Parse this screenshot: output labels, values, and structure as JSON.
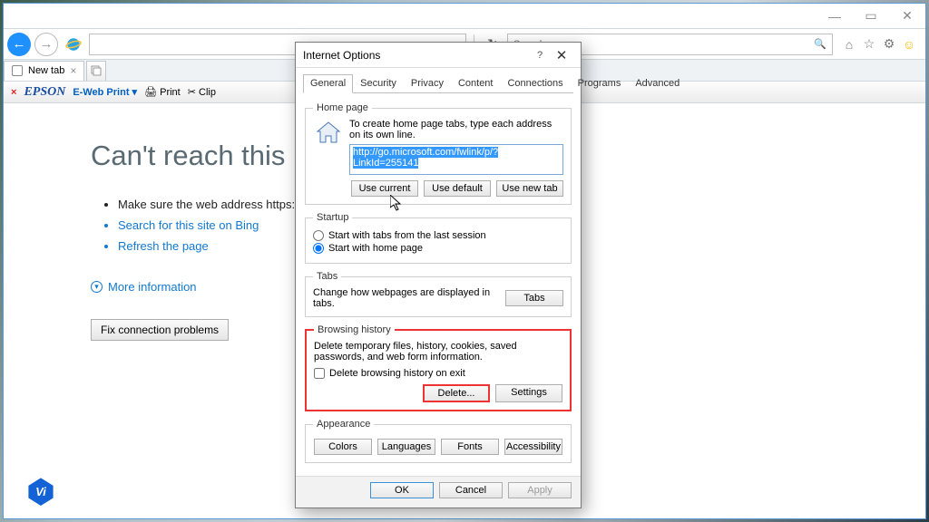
{
  "window": {
    "controls": {
      "min": "—",
      "max": "▭",
      "close": "✕"
    }
  },
  "navbar": {
    "search_placeholder": "Search...",
    "icons": {
      "home": "⌂",
      "star": "☆",
      "gear": "⚙",
      "smile": "☺"
    }
  },
  "tabstrip": {
    "tab_label": "New tab"
  },
  "toolbar": {
    "epson": "EPSON",
    "eweb": "E-Web Print",
    "dropdown": "▾",
    "print": "Print",
    "clip": "Clip"
  },
  "errorpage": {
    "title": "Can't reach this pa",
    "bullet1": "Make sure the web address https://",
    "bullet2": "Search for this site on Bing",
    "bullet3": "Refresh the page",
    "moreinfo": "More information",
    "fixbtn": "Fix connection problems"
  },
  "dialog": {
    "title": "Internet Options",
    "help": "?",
    "close": "✕",
    "tabs": [
      "General",
      "Security",
      "Privacy",
      "Content",
      "Connections",
      "Programs",
      "Advanced"
    ],
    "active_tab": "General",
    "homepage": {
      "legend": "Home page",
      "desc": "To create home page tabs, type each address on its own line.",
      "url": "http://go.microsoft.com/fwlink/p/?LinkId=255141",
      "use_current": "Use current",
      "use_default": "Use default",
      "use_newtab": "Use new tab"
    },
    "startup": {
      "legend": "Startup",
      "opt1": "Start with tabs from the last session",
      "opt2": "Start with home page"
    },
    "tabs_section": {
      "legend": "Tabs",
      "desc": "Change how webpages are displayed in tabs.",
      "btn": "Tabs"
    },
    "history": {
      "legend": "Browsing history",
      "desc": "Delete temporary files, history, cookies, saved passwords, and web form information.",
      "check": "Delete browsing history on exit",
      "delete": "Delete...",
      "settings": "Settings"
    },
    "appearance": {
      "legend": "Appearance",
      "colors": "Colors",
      "languages": "Languages",
      "fonts": "Fonts",
      "accessibility": "Accessibility"
    },
    "footer": {
      "ok": "OK",
      "cancel": "Cancel",
      "apply": "Apply"
    }
  }
}
